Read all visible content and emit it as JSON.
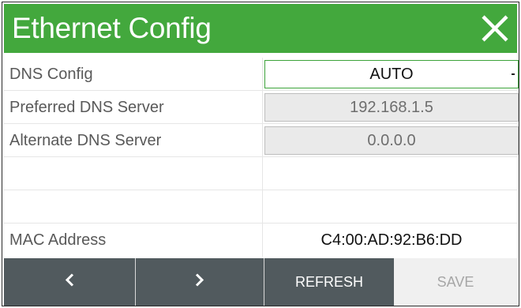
{
  "dialog": {
    "title": "Ethernet Config",
    "close_icon": "close-icon"
  },
  "rows": [
    {
      "label": "DNS Config",
      "value": "AUTO",
      "kind": "select"
    },
    {
      "label": "Preferred DNS Server",
      "value": "192.168.1.5",
      "kind": "readonly-field"
    },
    {
      "label": "Alternate DNS Server",
      "value": "0.0.0.0",
      "kind": "readonly-field"
    },
    {
      "label": "",
      "value": "",
      "kind": "empty"
    },
    {
      "label": "",
      "value": "",
      "kind": "empty"
    },
    {
      "label": "MAC Address",
      "value": "C4:00:AD:92:B6:DD",
      "kind": "text"
    }
  ],
  "footer": {
    "prev_icon": "chevron-left-icon",
    "next_icon": "chevron-right-icon",
    "refresh_label": "REFRESH",
    "save_label": "SAVE"
  },
  "colors": {
    "header": "#43a83d",
    "footer_dark": "#515a5e",
    "footer_light": "#f0f0f0",
    "select_border": "#3ca33a"
  }
}
